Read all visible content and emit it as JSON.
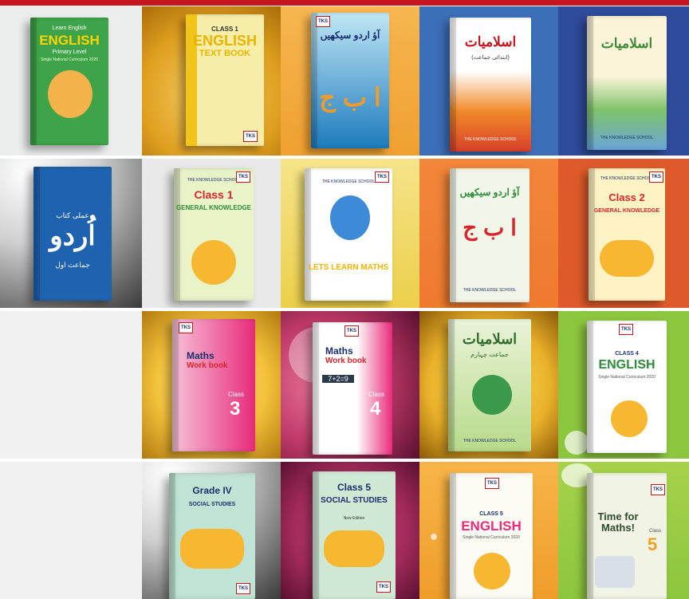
{
  "colors": {
    "brand_red": "#c4161c",
    "tks_blue": "#1a2f6e"
  },
  "books": [
    {
      "title": "ENGLISH",
      "pre": "Learn English",
      "sub": "Primary Level",
      "note": "Single National Curriculum 2020"
    },
    {
      "pre": "CLASS 1",
      "title": "ENGLISH",
      "title2": "TEXT BOOK"
    },
    {
      "title": "آؤ اردو سیکھیں",
      "big": "ا ب ج",
      "logo": "TKS"
    },
    {
      "title": "اسلامیات",
      "sub": "(ابتدائی جماعت)",
      "footer": "THE KNOWLEDGE SCHOOL"
    },
    {
      "title": "اسلامیات",
      "footer": "THE KNOWLEDGE SCHOOL"
    },
    {
      "pre": "عملی کتاب",
      "title": "اُردو",
      "sub": "جماعت اول"
    },
    {
      "logo": "TKS",
      "pre": "THE KNOWLEDGE SCHOOL",
      "title": "Class 1",
      "title2": "GENERAL KNOWLEDGE"
    },
    {
      "logo": "TKS",
      "pre": "THE KNOWLEDGE SCHOOL",
      "title": "LETS LEARN MATHS"
    },
    {
      "title": "آؤ اردو سیکھیں",
      "big": "ا ب ج",
      "footer": "THE KNOWLEDGE SCHOOL"
    },
    {
      "logo": "TKS",
      "pre": "THE KNOWLEDGE SCHOOL",
      "title": "Class 2",
      "title2": "GENERAL KNOWLEDGE"
    },
    {
      "logo": "TKS",
      "title": "Maths",
      "title2": "Work book",
      "cls": "Class",
      "num": "3"
    },
    {
      "logo": "TKS",
      "title": "Maths",
      "title2": "Work book",
      "eq": "7+2=9",
      "cls": "Class",
      "num": "4"
    },
    {
      "title": "اسلامیات",
      "sub": "جماعت چہارم",
      "footer": "THE KNOWLEDGE SCHOOL"
    },
    {
      "logo": "TKS",
      "pre": "CLASS 4",
      "title": "ENGLISH",
      "sub": "Single National Curriculum 2020"
    },
    {
      "title": "Grade IV",
      "title2": "SOCIAL STUDIES",
      "logo": "TKS"
    },
    {
      "title": "Class 5",
      "title2": "SOCIAL STUDIES",
      "sub": "New Edition",
      "logo": "TKS"
    },
    {
      "logo": "TKS",
      "pre": "CLASS 5",
      "title": "ENGLISH",
      "sub": "Single National Curriculum 2020"
    },
    {
      "logo": "TKS",
      "title": "Time for Maths!",
      "cls": "Class",
      "num": "5"
    }
  ]
}
